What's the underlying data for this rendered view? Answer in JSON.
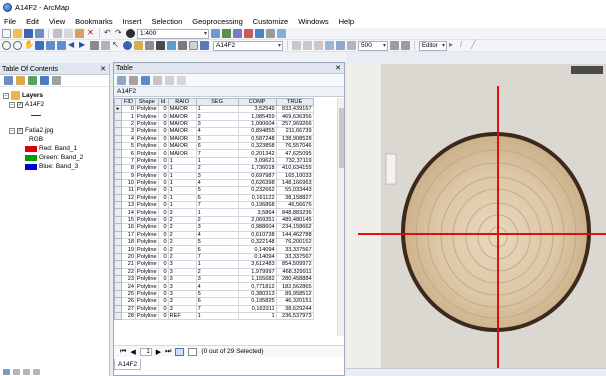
{
  "window": {
    "title": "A14F2 - ArcMap"
  },
  "menu": [
    "File",
    "Edit",
    "View",
    "Bookmarks",
    "Insert",
    "Selection",
    "Geoprocessing",
    "Customize",
    "Windows",
    "Help"
  ],
  "toolbar": {
    "scale_value": "1:400",
    "layer_value": "A14F2",
    "zoom_percent": "500",
    "editor_label": "Editor"
  },
  "toc": {
    "title": "Table Of Contents",
    "layers_label": "Layers",
    "feature_layer": "A14F2",
    "raster_layer": "Fatia2.jpg",
    "raster_mode": "RGB",
    "bands": [
      {
        "label": "Red:",
        "band": "Band_1",
        "color": "#e00000"
      },
      {
        "label": "Green:",
        "band": "Band_2",
        "color": "#00a000"
      },
      {
        "label": "Blue:",
        "band": "Band_3",
        "color": "#0000d0"
      }
    ]
  },
  "table": {
    "title": "Table",
    "tab_name": "A14F2",
    "columns": [
      "FID",
      "Shape",
      "Id",
      "RAIO",
      "SEG",
      "COMP",
      "TRUE"
    ],
    "rows": [
      [
        "0",
        "Polyline",
        "0",
        "MAIOR",
        "1",
        "3,52549",
        "833,439167"
      ],
      [
        "1",
        "Polyline",
        "0",
        "MAIOR",
        "2",
        "1,985459",
        "469,636356"
      ],
      [
        "2",
        "Polyline",
        "0",
        "MAIOR",
        "3",
        "1,090604",
        "257,969266"
      ],
      [
        "3",
        "Polyline",
        "0",
        "MAIOR",
        "4",
        "0,894855",
        "211,66739"
      ],
      [
        "4",
        "Polyline",
        "0",
        "MAIOR",
        "5",
        "0,587248",
        "138,908528"
      ],
      [
        "5",
        "Polyline",
        "0",
        "MAIOR",
        "6",
        "0,323858",
        "76,557046"
      ],
      [
        "6",
        "Polyline",
        "0",
        "MAIOR",
        "7",
        "0,201342",
        "47,625095"
      ],
      [
        "7",
        "Polyline",
        "0",
        "1",
        "1",
        "3,09621",
        "732,37119"
      ],
      [
        "8",
        "Polyline",
        "0",
        "1",
        "2",
        "1,736018",
        "410,634155"
      ],
      [
        "9",
        "Polyline",
        "0",
        "1",
        "3",
        "0,697987",
        "165,10033"
      ],
      [
        "10",
        "Polyline",
        "0",
        "1",
        "4",
        "0,626398",
        "148,166963"
      ],
      [
        "11",
        "Polyline",
        "0",
        "1",
        "5",
        "0,232662",
        "55,033443"
      ],
      [
        "12",
        "Polyline",
        "0",
        "1",
        "6",
        "0,161122",
        "38,158827"
      ],
      [
        "13",
        "Polyline",
        "0",
        "1",
        "7",
        "0,196868",
        "46,56676"
      ],
      [
        "14",
        "Polyline",
        "0",
        "2",
        "1",
        "3,5864",
        "848,883236"
      ],
      [
        "15",
        "Polyline",
        "0",
        "2",
        "2",
        "2,069351",
        "489,480145"
      ],
      [
        "16",
        "Polyline",
        "0",
        "2",
        "3",
        "0,988604",
        "234,158662"
      ],
      [
        "17",
        "Polyline",
        "0",
        "2",
        "4",
        "0,610738",
        "144,462788"
      ],
      [
        "18",
        "Polyline",
        "0",
        "2",
        "5",
        "0,322148",
        "76,200152"
      ],
      [
        "19",
        "Polyline",
        "0",
        "2",
        "6",
        "0,14094",
        "33,337567"
      ],
      [
        "20",
        "Polyline",
        "0",
        "2",
        "7",
        "0,14094",
        "33,337567"
      ],
      [
        "21",
        "Polyline",
        "0",
        "3",
        "1",
        "3,612483",
        "854,509972"
      ],
      [
        "22",
        "Polyline",
        "0",
        "3",
        "2",
        "1,979997",
        "468,329911"
      ],
      [
        "23",
        "Polyline",
        "0",
        "3",
        "3",
        "1,155682",
        "280,458884"
      ],
      [
        "24",
        "Polyline",
        "0",
        "3",
        "4",
        "0,771812",
        "182,562865"
      ],
      [
        "25",
        "Polyline",
        "0",
        "3",
        "5",
        "0,380313",
        "89,958512"
      ],
      [
        "26",
        "Polyline",
        "0",
        "3",
        "6",
        "0,195825",
        "46,320151"
      ],
      [
        "27",
        "Polyline",
        "0",
        "3",
        "7",
        "0,163311",
        "38,629244"
      ],
      [
        "28",
        "Polyline",
        "0",
        "REF",
        "1",
        "1",
        "236,537973"
      ]
    ],
    "nav_record": "1",
    "selection_status": "(0 out of 29 Selected)"
  }
}
